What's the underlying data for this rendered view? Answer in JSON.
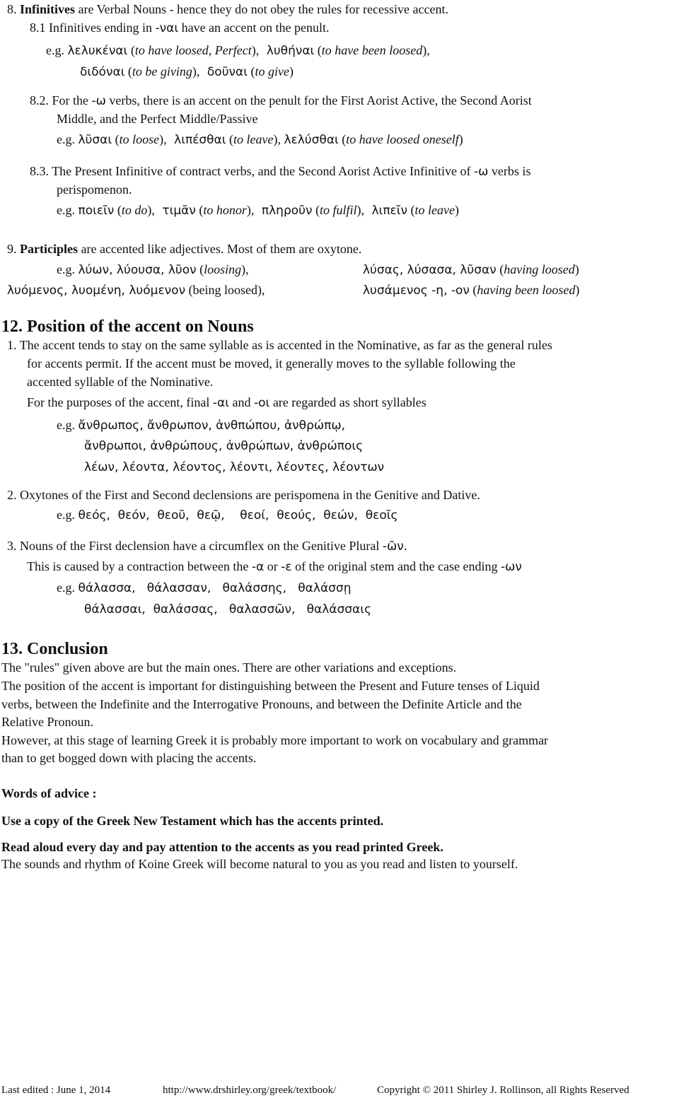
{
  "s8": {
    "num": "8.",
    "title": "Infinitives",
    "text": "are Verbal Nouns - hence they do not obey the rules for recessive accent.",
    "s81": {
      "num": "8.1",
      "pre": "Infinitives ending in",
      "ending": "-ναι",
      "post": "have an accent on the penult.",
      "eg": "e.g.",
      "examples": [
        {
          "greek": "λελυκέναι",
          "gloss_a": "(",
          "gloss_i": "to have loosed, Perfect",
          "gloss_b": "),"
        },
        {
          "greek": "λυθήναι",
          "gloss_a": "(",
          "gloss_i": "to have been loosed",
          "gloss_b": "),"
        },
        {
          "greek": "διδόναι",
          "gloss_a": "(",
          "gloss_i": "to be giving",
          "gloss_b": "),"
        },
        {
          "greek": "δοῦναι",
          "gloss_a": "(",
          "gloss_i": "to give",
          "gloss_b": ")"
        }
      ]
    },
    "s82": {
      "num": "8.2.",
      "pre": "For the",
      "ending": "-ω",
      "line1": "verbs, there is an accent on the penult for the First Aorist Active, the Second Aorist",
      "line2": "Middle, and the Perfect Middle/Passive",
      "eg": "e.g.",
      "examples": [
        {
          "greek": "λῦσαι",
          "gloss_i": "to loose",
          "tail": "),"
        },
        {
          "greek": "λιπέσθαι",
          "gloss_i": "to leave",
          "tail": "),"
        },
        {
          "greek": "λελύσθαι",
          "gloss_i": "to have loosed oneself",
          "tail": ")"
        }
      ]
    },
    "s83": {
      "num": "8.3.",
      "line1a": "The Present Infinitive of contract verbs, and the Second Aorist Active Infinitive of",
      "ending": "-ω",
      "line1b": "verbs is",
      "line2": "perispomenon.",
      "eg": "e.g.",
      "examples": [
        {
          "greek": "ποιεῖν",
          "gloss_i": "to do",
          "tail": "),"
        },
        {
          "greek": "τιμᾶν",
          "gloss_i": "to honor",
          "tail": "),"
        },
        {
          "greek": "πληροῦν",
          "gloss_i": "to fulfil",
          "tail": "),"
        },
        {
          "greek": "λιπεῖν",
          "gloss_i": "to leave",
          "tail": ")"
        }
      ]
    }
  },
  "s9": {
    "num": "9.",
    "title": "Participles",
    "text": "are accented like adjectives.  Most of them are oxytone.",
    "eg": "e.g.",
    "row1a_greek": "λύων, λύουσα, λῦον",
    "row1a_gloss": "loosing",
    "row1b_greek": "λύσας, λύσασα, λῦσαν",
    "row1b_gloss": "having loosed",
    "row2a_greek": "λυόμενος, λυομένη, λυόμενον",
    "row2a_gloss": "(being loosed),",
    "row2b_greek": "λυσάμενος -η, -ον",
    "row2b_gloss": "having been loosed"
  },
  "s12": {
    "heading": "12.  Position of the accent on Nouns",
    "p1": {
      "num": "1.",
      "line1": "The accent tends to stay on the same syllable as is accented in the Nominative, as far as the general rules",
      "line2": "for accents permit.  If the accent must be moved, it generally moves to the syllable following the",
      "line3": "accented syllable of the Nominative.",
      "note_pre": "For the purposes of the accent,  final",
      "note_e1": "-αι",
      "note_mid": "and",
      "note_e2": "-οι",
      "note_post": "are regarded as short syllables",
      "eg": "e.g.",
      "rows": [
        "ἄνθρωπος,  ἄνθρωπον,  ἀνθπώπου,  ἀνθρώπῳ,",
        "ἄνθρωποι,  ἀνθρώπους,  ἀνθρώπων,  ἀνθρώποις",
        "λέων,  λέοντα,  λέοντος,  λέοντι,  λέοντες,  λέοντων"
      ]
    },
    "p2": {
      "num": "2.",
      "text": "Oxytones of  the First and Second declensions are perispomena in the Genitive and Dative.",
      "eg": "e.g.",
      "row": "θεός,  θεόν,  θεοῦ,  θεῷ,    θεοί,  θεούς,  θεών,  θεοῖς"
    },
    "p3": {
      "num": "3.",
      "text": "Nouns of the First declension have a circumflex on the Genitive Plural",
      "ending": "-ῶν.",
      "line2a": "This is caused by a contraction between the",
      "e1": "-α",
      "or": "or",
      "e2": "-ε",
      "line2b": "of the original stem and the case ending",
      "e3": "-ων",
      "eg": "e.g.",
      "rows": [
        "θάλασσα,   θάλασσαν,   θαλάσσης,   θαλάσσῃ",
        "θάλασσαι,  θαλάσσας,   θαλασσῶν,   θαλάσσαις"
      ]
    }
  },
  "s13": {
    "heading": "13.  Conclusion",
    "lines": [
      "The \"rules\" given above are but the main ones.  There are other variations and exceptions.",
      "The position of the accent is important for distinguishing between the Present and Future tenses of Liquid",
      "verbs, between the Indefinite and the Interrogative Pronouns, and between the Definite Article and the",
      "Relative Pronoun.",
      "However, at this stage of learning Greek it is probably more important to work on vocabulary and grammar",
      "than to get bogged down with placing the accents."
    ]
  },
  "advice": {
    "title": "Words of advice :",
    "tip1": "Use a copy of the Greek New Testament  which has the accents printed.",
    "tip2": "Read aloud every day and pay attention to the accents as you read printed Greek.",
    "tip2_note": "The sounds and rhythm of Koine Greek will become natural to you as you read and listen to yourself."
  },
  "footer": {
    "edited": "Last edited :   June 1, 2014",
    "url": "http://www.drshirley.org/greek/textbook/",
    "copyright": "Copyright © 2011 Shirley J. Rollinson, all Rights Reserved"
  }
}
